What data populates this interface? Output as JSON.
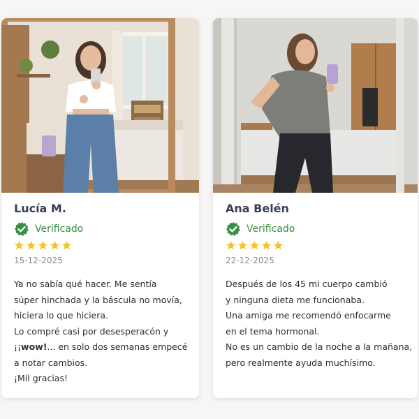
{
  "reviews": [
    {
      "name": "Lucía M.",
      "verified_label": "Verificado",
      "verified_icon": "verified-check-icon",
      "rating": 5,
      "rating_max": 5,
      "date": "15-12-2025",
      "lines": [
        "Ya no sabía qué hacer. Me sentía",
        "súper hinchada y la báscula no movía,",
        "hiciera lo que hiciera.",
        "Lo compré casi por desesperacón y",
        "¡¡",
        "wow!",
        "... en solo dos semanas empecé",
        "a notar cambios.",
        "¡Mil gracias!"
      ]
    },
    {
      "name": "Ana Belén",
      "verified_label": "Verificado",
      "verified_icon": "verified-check-icon",
      "rating": 5,
      "rating_max": 5,
      "date": "22-12-2025",
      "lines": [
        "Después de los 45 mi cuerpo cambió",
        "y ninguna dieta me funcionaba.",
        "Una amiga me recomendó enfocarme",
        "en el tema hormonal.",
        "No es un cambio de la noche a la mañana,",
        "pero realmente ayuda muchísimo."
      ]
    }
  ],
  "colors": {
    "verified_green": "#3a8f43",
    "star_gold": "#f4c430",
    "name_color": "#374056",
    "date_color": "#8a8a8a"
  }
}
